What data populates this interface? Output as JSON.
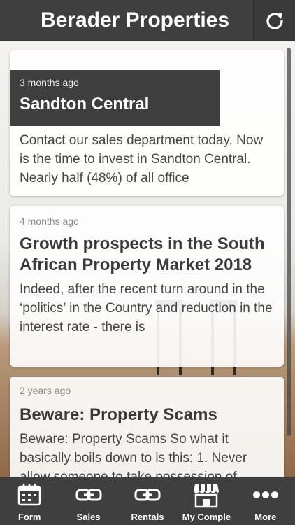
{
  "header": {
    "title": "Berader Properties",
    "refresh_icon": "refresh-icon"
  },
  "posts": [
    {
      "date": "3 months ago",
      "title": "Sandton Central",
      "excerpt": "Contact our sales department today, Now is the time to invest in Sandton Central. Nearly half (48%) of all office"
    },
    {
      "date": "4 months ago",
      "title": "Growth prospects in the South African Property Market 2018",
      "excerpt": "Indeed, after the recent turn around in the ‘politics’ in the Country and reduction in the interest rate - there is"
    },
    {
      "date": "2 years ago",
      "title": "Beware: Property Scams",
      "excerpt": "Beware: Property Scams So what it basically boils down to is this: 1. Never allow someone to take possession of"
    }
  ],
  "tabs": [
    {
      "label": "Form",
      "icon": "calendar-icon"
    },
    {
      "label": "Sales",
      "icon": "chain-link-icon"
    },
    {
      "label": "Rentals",
      "icon": "chain-link-icon"
    },
    {
      "label": "My Comple",
      "icon": "storefront-icon"
    },
    {
      "label": "More",
      "icon": "more-dots-icon"
    }
  ],
  "colors": {
    "bar": "#3f3f3f",
    "card": "#ffffff",
    "text": "#3a3a3a"
  }
}
